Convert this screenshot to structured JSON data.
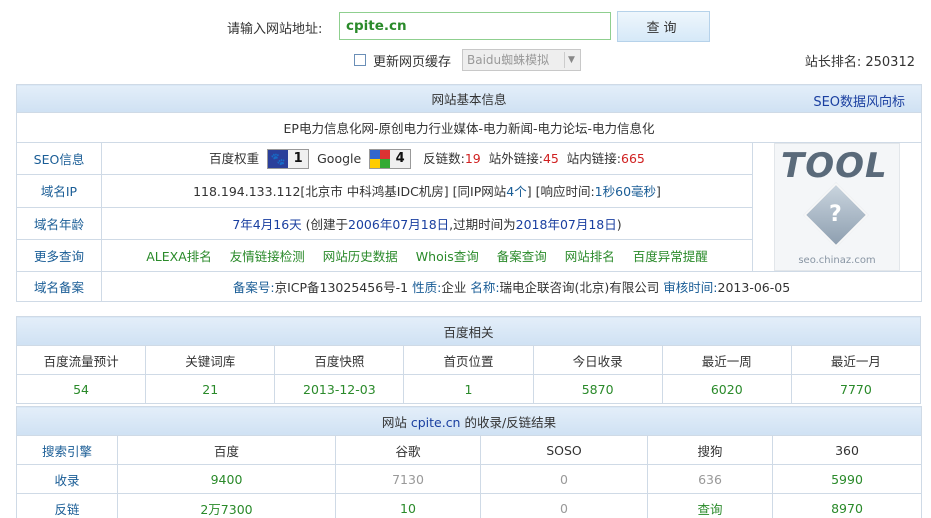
{
  "search": {
    "label": "请输入网站地址:",
    "value": "cpite.cn",
    "button": "查询",
    "refresh_label": "更新网页缓存",
    "spider_selected": "Baidu蜘蛛模拟",
    "rank_label": "站长排名:",
    "rank_value": "250312"
  },
  "basic": {
    "header": "网站基本信息",
    "seo_link": "SEO数据风向标",
    "site_title": "EP电力信息化网-原创电力行业媒体-电力新闻-电力论坛-电力信息化",
    "seo_label": "SEO信息",
    "baidu_weight_label": "百度权重",
    "baidu_weight": "1",
    "google_label": "Google",
    "google_pr": "4",
    "backlinks_label": "反链数:",
    "backlinks": "19",
    "external_label": "站外链接:",
    "external": "45",
    "internal_label": "站内链接:",
    "internal": "665",
    "ip_label": "域名IP",
    "ip_text": "118.194.133.112[北京市 中科鸿基IDC机房]  [同IP网站",
    "ip_count": "4个",
    "ip_resp_label": "]  [响应时间:",
    "ip_resp_value": "1秒60毫秒",
    "ip_end": "]",
    "age_label": "域名年龄",
    "age_value": "7年4月16天",
    "age_created_pre": "(创建于",
    "age_created": "2006年07月18日",
    "age_expire_pre": ",过期时间为",
    "age_expire": "2018年07月18日",
    "age_end": ")",
    "more_label": "更多查询",
    "more_links": [
      "ALEXA排名",
      "友情链接检测",
      "网站历史数据",
      "Whois查询",
      "备案查询",
      "网站排名",
      "百度异常提醒"
    ],
    "beian_label": "域名备案",
    "beian_no_label": "备案号:",
    "beian_no": "京ICP备13025456号-1",
    "nature_label": "性质:",
    "nature": "企业",
    "name_label": "名称:",
    "name": "瑞电企联咨询(北京)有限公司",
    "audit_label": "审核时间:",
    "audit": "2013-06-05",
    "logo_text": "TOOL",
    "logo_site": "seo.chinaz.com"
  },
  "baidu": {
    "header": "百度相关",
    "cols": [
      "百度流量预计",
      "关键词库",
      "百度快照",
      "首页位置",
      "今日收录",
      "最近一周",
      "最近一月"
    ],
    "vals": [
      "54",
      "21",
      "2013-12-03",
      "1",
      "5870",
      "6020",
      "7770"
    ]
  },
  "index": {
    "header_pre": "网站",
    "header_site": "cpite.cn",
    "header_post": "的收录/反链结果",
    "cols": [
      "搜索引擎",
      "百度",
      "谷歌",
      "SOSO",
      "搜狗",
      "360"
    ],
    "row1": [
      "收录",
      "9400",
      "7130",
      "0",
      "636",
      "5990"
    ],
    "row2": [
      "反链",
      "2万7300",
      "10",
      "0",
      "查询",
      "8970"
    ]
  },
  "colors": {
    "link_blue": "#1a5d96",
    "value_green": "#2a8a2a",
    "value_red": "#d02020",
    "header_bg": "#d8e7f6"
  }
}
